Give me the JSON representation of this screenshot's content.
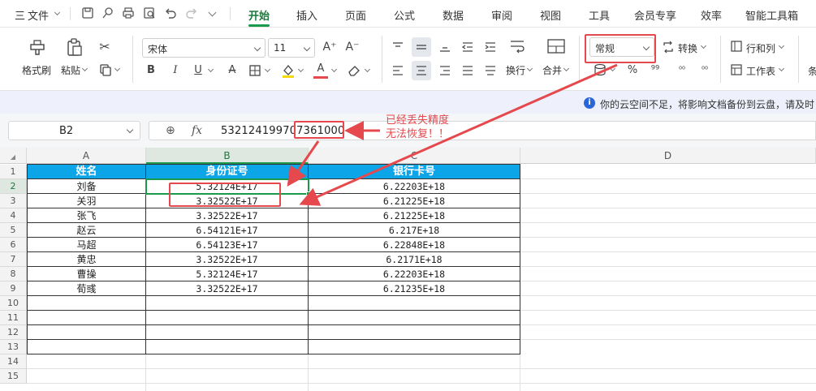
{
  "menubar": {
    "hamburger": "三",
    "file": "文件",
    "tabs": [
      "开始",
      "插入",
      "页面",
      "公式",
      "数据",
      "审阅",
      "视图",
      "工具",
      "会员专享",
      "效率",
      "智能工具箱"
    ],
    "active_tab": "开始"
  },
  "ribbon": {
    "format_painter": "格式刷",
    "paste": "粘贴",
    "font_name": "宋体",
    "font_size": "11",
    "number_format": "常规",
    "convert": "转换",
    "rows_cols": "行和列",
    "worksheet": "工作表",
    "wrap": "换行",
    "merge": "合并",
    "cond_format": "条"
  },
  "notice": {
    "icon": "i",
    "text": "你的云空间不足，将影响文档备份到云盘，请及时"
  },
  "formula": {
    "name_box": "B2",
    "zoom_icon": "⊕",
    "fx": "fx",
    "value": "532124199707361000"
  },
  "annotation": {
    "line1": "已经丢失精度",
    "line2": "无法恢复！！"
  },
  "grid": {
    "columns": [
      "A",
      "B",
      "C",
      "D"
    ],
    "rows": [
      "1",
      "2",
      "3",
      "4",
      "5",
      "6",
      "7",
      "8",
      "9",
      "10",
      "11",
      "12",
      "13",
      "14",
      "15"
    ],
    "headers": [
      "姓名",
      "身份证号",
      "银行卡号"
    ],
    "data": [
      [
        "刘备",
        "5.32124E+17",
        "6.22203E+18"
      ],
      [
        "关羽",
        "3.32522E+17",
        "6.21225E+18"
      ],
      [
        "张飞",
        "3.32522E+17",
        "6.21225E+18"
      ],
      [
        "赵云",
        "6.54121E+17",
        "6.217E+18"
      ],
      [
        "马超",
        "6.54123E+17",
        "6.22848E+18"
      ],
      [
        "黄忠",
        "3.32522E+17",
        "6.2171E+18"
      ],
      [
        "曹操",
        "5.32124E+17",
        "6.22203E+18"
      ],
      [
        "荀彧",
        "3.32522E+17",
        "6.21235E+18"
      ]
    ]
  },
  "colors": {
    "accent": "#1a9a4a",
    "header_fill": "#0ba5e8",
    "annotation": "#e5484d"
  }
}
